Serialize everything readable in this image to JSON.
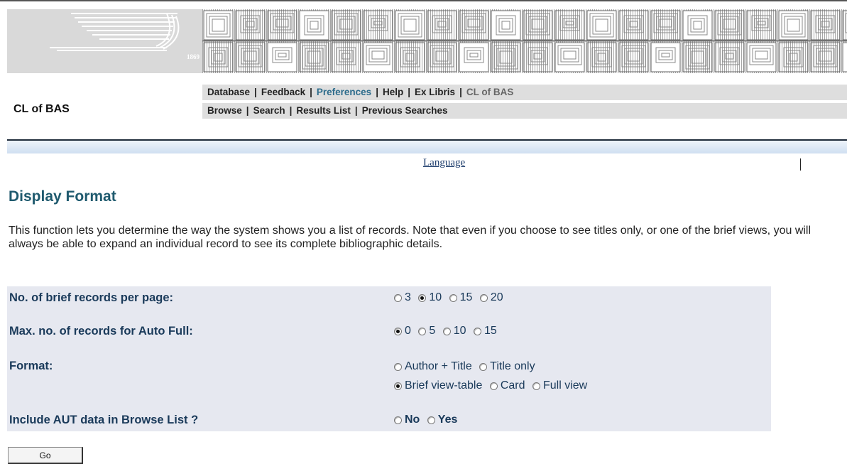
{
  "logo": {
    "year": "1869"
  },
  "nav_top": {
    "items": [
      "Database",
      "Feedback",
      "Preferences",
      "Help",
      "Ex Libris",
      "CL of BAS"
    ]
  },
  "nav_bottom": {
    "items": [
      "Browse",
      "Search",
      "Results List",
      "Previous Searches"
    ]
  },
  "site_name": "CL of BAS",
  "language_link": "Language",
  "page_title": "Display Format",
  "intro_text": "This function lets you determine the way the system shows you a list of records. Note that even if you choose to see titles only, or one of the brief views, you will always be able to expand an individual record to see its complete bibliographic details.",
  "form": {
    "brief_records": {
      "label": "No. of brief records per page:",
      "options": [
        "3",
        "10",
        "15",
        "20"
      ],
      "selected": "10"
    },
    "auto_full": {
      "label": "Max. no. of records for Auto Full:",
      "options": [
        "0",
        "5",
        "10",
        "15"
      ],
      "selected": "0"
    },
    "format": {
      "label": "Format:",
      "options": [
        "Author + Title",
        "Title only",
        "Brief view-table",
        "Card",
        "Full view"
      ],
      "selected": "Brief view-table"
    },
    "aut_data": {
      "label": "Include AUT data in Browse List ?",
      "options": [
        "No",
        "Yes"
      ],
      "selected": ""
    }
  },
  "go_button": "Go",
  "colors": {
    "heading": "#1f5a6e",
    "label": "#1a3a5a",
    "nav_active": "#2d6c8c",
    "panel": "#e6e8f0",
    "nav_bar": "#dedede"
  }
}
